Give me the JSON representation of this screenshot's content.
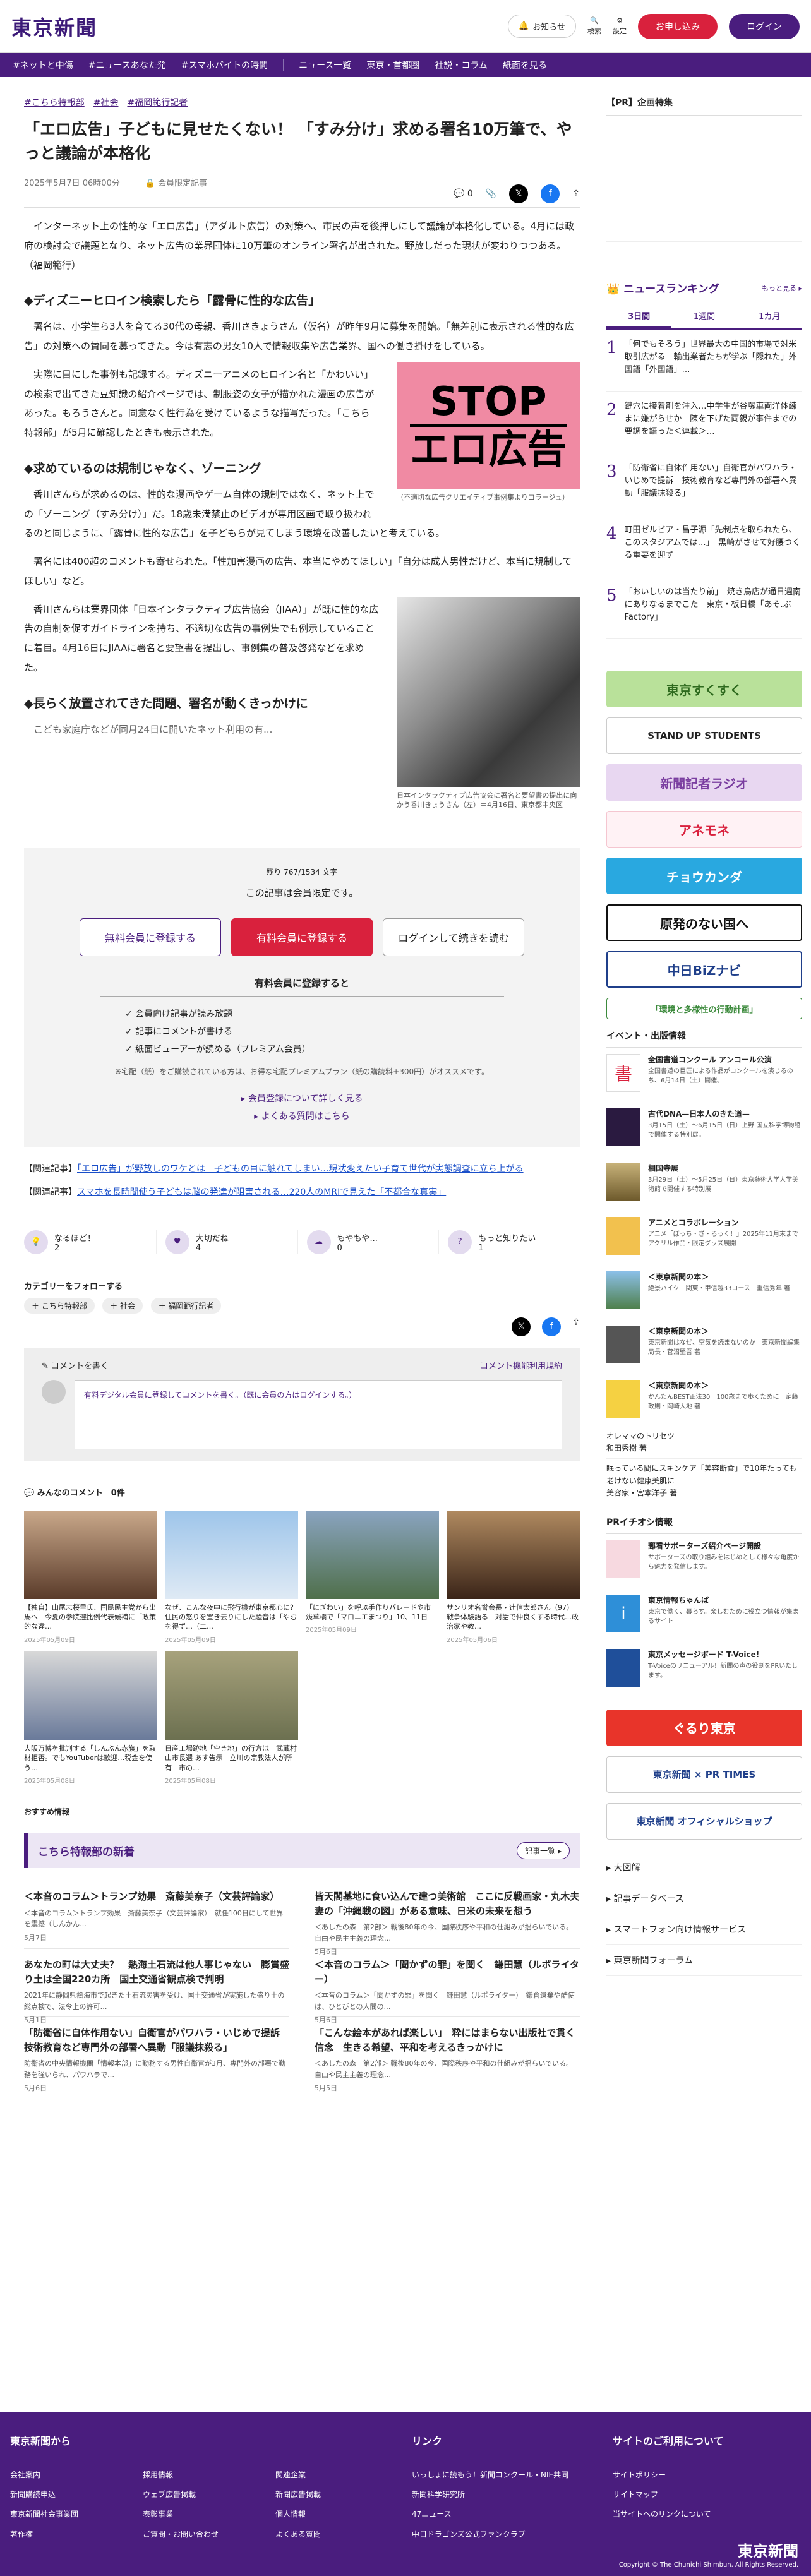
{
  "header": {
    "logo": "東京新聞",
    "notice": "お知らせ",
    "search": "検索",
    "settings": "設定",
    "apply": "お申し込み",
    "login": "ログイン"
  },
  "nav": [
    "#ネットと中傷",
    "#ニュースあなた発",
    "#スマホバイトの時間",
    "ニュース一覧",
    "東京・首都圏",
    "社説・コラム",
    "紙面を見る"
  ],
  "article": {
    "tags": [
      "#こちら特報部",
      "#社会",
      "#福岡範行記者"
    ],
    "title": "「エロ広告」子どもに見せたくない！ 「すみ分け」求める署名10万筆で、やっと議論が本格化",
    "date": "2025年5月7日 06時00分",
    "members_label": "会員限定記事",
    "comment_count": "0",
    "paragraphs": [
      "インターネット上の性的な「エロ広告」（アダルト広告）の対策へ、市民の声を後押しにして議論が本格化している。4月には政府の検討会で議題となり、ネット広告の業界団体に10万筆のオンライン署名が出された。野放しだった現状が変わりつつある。（福岡範行）",
      "署名は、小学生ら3人を育てる30代の母親、香川さきょうさん（仮名）が昨年9月に募集を開始。「無差別に表示される性的な広告」の対策への賛同を募ってきた。今は有志の男女10人で情報収集や広告業界、国への働き掛けをしている。",
      "実際に目にした事例も記録する。ディズニーアニメのヒロイン名と「かわいい」の検索で出てきた豆知識の紹介ページでは、制服姿の女子が描かれた漫画の広告があった。もろうさんと。同意なく性行為を受けているような描写だった。「こちら特報部」が5月に確認したときも表示された。",
      "香川さんらが求めるのは、性的な漫画やゲーム自体の規制ではなく、ネット上での「ゾーニング（すみ分け）」だ。18歳未満禁止のビデオが専用区画で取り扱われるのと同じように、「露骨に性的な広告」を子どもらが見てしまう環境を改善したいと考えている。",
      "署名には400超のコメントも寄せられた。「性加害漫画の広告、本当にやめてほしい」「自分は成人男性だけど、本当に規制してほしい」など。",
      "香川さんらは業界団体「日本インタラクティブ広告協会（JIAA）」が既に性的な広告の自制を促すガイドラインを持ち、不適切な広告の事例集でも例示していることに着目。4月16日にJIAAに署名と要望書を提出し、事例集の普及啓発などを求めた。",
      "こども家庭庁などが同月24日に開いたネット利用の有..."
    ],
    "h2": [
      "◆ディズニーヒロイン検索したら「露骨に性的な広告」",
      "◆求めているのは規制じゃなく、ゾーニング",
      "◆長らく放置されてきた問題、署名が動くきっかけに"
    ],
    "fig1_text": [
      "STOP",
      "エロ広告"
    ],
    "fig1_caption": "（不適切な広告クリエイティブ事例集よりコラージュ）",
    "fig2_caption": "日本インタラクティブ広告協会に署名と要望書の提出に向かう香川きょうさん（左）＝4月16日、東京都中央区"
  },
  "paywall": {
    "remaining": "残り 767/1534 文字",
    "lead": "この記事は会員限定です。",
    "free": "無料会員に登録する",
    "paid": "有料会員に登録する",
    "login": "ログインして続きを読む",
    "sub": "有料会員に登録すると",
    "perks": [
      "✓ 会員向け記事が読み放題",
      "✓ 記事にコメントが書ける",
      "✓ 紙面ビューアーが読める（プレミアム会員）"
    ],
    "note": "※宅配（紙）をご購読されている方は、お得な宅配プレミアムプラン（紙の購読料+300円）がオススメです。",
    "more1": "▸ 会員登録について詳しく見る",
    "more2": "▸ よくある質問はこちら"
  },
  "related": [
    {
      "label": "【関連記事】",
      "text": "「エロ広告」が野放しのワケとは　子どもの目に触れてしまい…現状変えたい子育て世代が実態調査に立ち上がる"
    },
    {
      "label": "【関連記事】",
      "text": "スマホを長時間使う子どもは脳の発達が阻害される…220人のMRIで見えた「不都合な真実」"
    }
  ],
  "reactions": [
    {
      "label": "なるほど！",
      "count": "2"
    },
    {
      "label": "大切だね",
      "count": "4"
    },
    {
      "label": "もやもや...",
      "count": "0"
    },
    {
      "label": "もっと知りたい",
      "count": "1"
    }
  ],
  "follow": {
    "title": "カテゴリーをフォローする",
    "chips": [
      "＋ こちら特報部",
      "＋ 社会",
      "＋ 福岡範行記者"
    ]
  },
  "comments": {
    "title": "コメントを書く",
    "policy": "コメント機能利用規約",
    "prompt": "有料デジタル会員に登録してコメントを書く。（既に会員の方はログインする。）",
    "all_title": "みんなのコメント　0件"
  },
  "grid": [
    {
      "c": "【独自】山尾志桜里氏、国民民主党から出馬へ　今夏の参院選比例代表候補に「政策的な違…",
      "d": "2025年05月09日"
    },
    {
      "c": "なぜ、こんな夜中に飛行機が東京都心に？住民の怒りを置き去りにした騒音は「やむを得ず…（二…",
      "d": "2025年05月09日"
    },
    {
      "c": "「にぎわい」を呼ぶ手作りパレードや市　浅草橋で「マロニエまつり」10、11日",
      "d": "2025年05月09日"
    },
    {
      "c": "サンリオ名誉会長・辻信太郎さん（97）戦争体験語る　対話で仲良くする時代…政治家や教…",
      "d": "2025年05月06日"
    },
    {
      "c": "大阪万博を批判する「しんぶん赤旗」を取材拒否。でもYouTuberは歓迎…税金を使う…",
      "d": "2025年05月08日"
    },
    {
      "c": "日産工場跡地「空き地」の行方は　武蔵村山市長選 あす告示　立川の宗教法人が所有　市の…",
      "d": "2025年05月08日"
    }
  ],
  "recommend": "おすすめ情報",
  "feed_title": "こちら特報部の新着",
  "feed_more": "記事一覧 ▸",
  "feed": [
    {
      "t": "＜本音のコラム＞トランプ効果　斎藤美奈子（文芸評論家）",
      "s": "＜本音のコラム＞トランプ効果　斎藤美奈子（文芸評論家）　就任100日にして世界を震撼（しんかん…",
      "d": "5月7日"
    },
    {
      "t": "皆天閣基地に食い込んで建つ美術館　ここに反戦画家・丸木夫妻の「沖縄戦の図」がある意味、日米の未来を想う",
      "s": "＜あしたの森　第2部＞ 戦後80年の今、国際秩序や平和の仕組みが揺らいでいる。自由や民主主義の理念…",
      "d": "5月6日"
    },
    {
      "t": "あなたの町は大丈夫？　熱海土石流は他人事じゃない　膨賞盛り土は全国220カ所　国土交通省観点検で判明",
      "s": "2021年に静岡県熱海市で起きた土石流災害を受け、国土交通省が実施した盛り土の総点検で、法令上の許可…",
      "d": "5月1日"
    },
    {
      "t": "＜本音のコラム＞「聞かずの罪」を聞く　鎌田慧（ルポライター）",
      "s": "＜本音のコラム＞「聞かずの罪」を聞く　鎌田慧（ルポライター）　鎌倉遺棄や酷使は、ひとびとの人間の…",
      "d": "5月6日"
    },
    {
      "t": "「防衛省に自体作用ない」自衛官がパワハラ・いじめで提訴　技術教育など専門外の部署へ異動「服議抹殺る」",
      "s": "防衛省の中央情報機関「情報本部」に勤務する男性自衛官が3月、専門外の部署で勤務を強いられ、パワハラで…",
      "d": "5月6日"
    },
    {
      "t": "「こんな絵本があれば楽しい」　粋にはまらない出版社で貫く信念　生きる希望、平和を考えるきっかけに",
      "s": "＜あしたの森　第2部＞ 戦後80年の今、国際秩序や平和の仕組みが揺らいでいる。自由や民主主義の理念…",
      "d": "5月5日"
    }
  ],
  "side": {
    "pr": "【PR】企画特集",
    "ranking_title": "ニュースランキング",
    "ranking_more": "もっと見る ▸",
    "tabs": [
      "3日間",
      "1週間",
      "1カ月"
    ],
    "ranking": [
      "「何でもそろう」世界最大の中国的市場で対米取引広がる　輸出業者たちが学ぶ「隠れた」外国語「外国語」…",
      "鍵穴に接着剤を注入…中学生が谷塚車両洋体練まに嫌がらせか　陳を下げた両親が事件までの要調を語った＜連載＞…",
      "「防衛省に自体作用ない」自衛官がパワハラ・いじめで提訴　技術教育など専門外の部署へ異動「服議抹殺る」",
      "町田ゼルビア・昌子源「先制点を取られたら、このスタジアムでは…」　黒崎がさせて好腰つくる重要を迎ず",
      "「おいしいのは当たり前」　焼き鳥店が通日週南にありなるまでこた　東京・板日橋「あそ.ぶFactory」"
    ],
    "banners": [
      "東京すくすく",
      "STAND UP STUDENTS",
      "新聞記者ラジオ",
      "アネモネ",
      "チョウカンダ",
      "原発のない国へ",
      "中日BiZナビ",
      "「環境と多様性の行動計画」"
    ],
    "events_title": "イベント・出版情報",
    "events": [
      {
        "t": "全国書道コンクール アンコール公演",
        "d": "全国書道の巨匠による作品がコンクールを演じるのち、6月14日（土）開催。"
      },
      {
        "t": "古代DNA—日本人のきた道—",
        "d": "3月15日（土）～6月15日（日）上野 国立科学博物館で開催する特別展。"
      },
      {
        "t": "相国寺展",
        "d": "3月29日（土）～5月25日（日）東京藝術大学大学美術館で開催する特別展"
      },
      {
        "t": "アニメとコラボレーション",
        "d": "アニメ「ぼっち・ざ・ろっく！」2025年11月末までアクリル作品・限定グッズ展開"
      },
      {
        "t": "＜東京新聞の本＞",
        "d": "絶景ハイク　関東・甲信越33コース　重信秀年 著"
      },
      {
        "t": "＜東京新聞の本＞",
        "d": "東京新聞はなぜ、空気を読まないのか　東京新聞編集局長・菅沼堅吾 著"
      },
      {
        "t": "＜東京新聞の本＞",
        "d": "かんたんBEST正法30　100歳まで歩くために　定藤政則・岡崎大地 著"
      }
    ],
    "book_lines": [
      "オレママのトリセツ",
      "和田秀樹 著",
      "眠っている間にスキンケア「美容断食」で10年たっても老けない健康美肌に",
      "美容家・宮本洋子 著"
    ],
    "pr_title": "PRイチオシ情報",
    "pr_items": [
      {
        "t": "郵看サポーターズ紹介ページ開設",
        "d": "サポーターズの取り組みをはじめとして様々な角度から魅力を発信します。"
      },
      {
        "t": "東京情報ちゃんぱ",
        "d": "東京で働く、暮らす。楽しむために役立つ情報が集まるサイト"
      },
      {
        "t": "東京メッセージボード T-Voice!",
        "d": "T-Voiceのリニューアル！新聞の声の役割をPRいたします。"
      }
    ],
    "tail_banners": [
      "ぐるり東京",
      "東京新聞 × PR TIMES",
      "東京新聞 オフィシャルショップ"
    ],
    "links": [
      "大図解",
      "記事データベース",
      "スマートフォン向け情報サービス",
      "東京新聞フォーラム"
    ]
  },
  "footer": {
    "col1_title": "東京新聞から",
    "col1": [
      [
        "会社案内",
        "採用情報",
        "関連企業"
      ],
      [
        "新聞購読申込",
        "ウェブ広告掲載",
        "新聞広告掲載"
      ],
      [
        "東京新聞社会事業団",
        "表彰事業",
        "個人情報"
      ],
      [
        "著作権",
        "ご質問・お問い合わせ",
        "よくある質問"
      ]
    ],
    "col2_title": "リンク",
    "col2": [
      "いっしょに読もう！新聞コンクール・NIE共同",
      "新聞科学研究所",
      "47ニュース",
      "中日ドラゴンズ公式ファンクラブ"
    ],
    "col3_title": "サイトのご利用について",
    "col3": [
      "サイトポリシー",
      "サイトマップ",
      "当サイトへのリンクについて"
    ],
    "logo": "東京新聞",
    "copy": "Copyright © The Chunichi Shimbun, All Rights Reserved."
  },
  "colors": {
    "brand": "#4a1d7e",
    "accent": "#d9213d"
  }
}
